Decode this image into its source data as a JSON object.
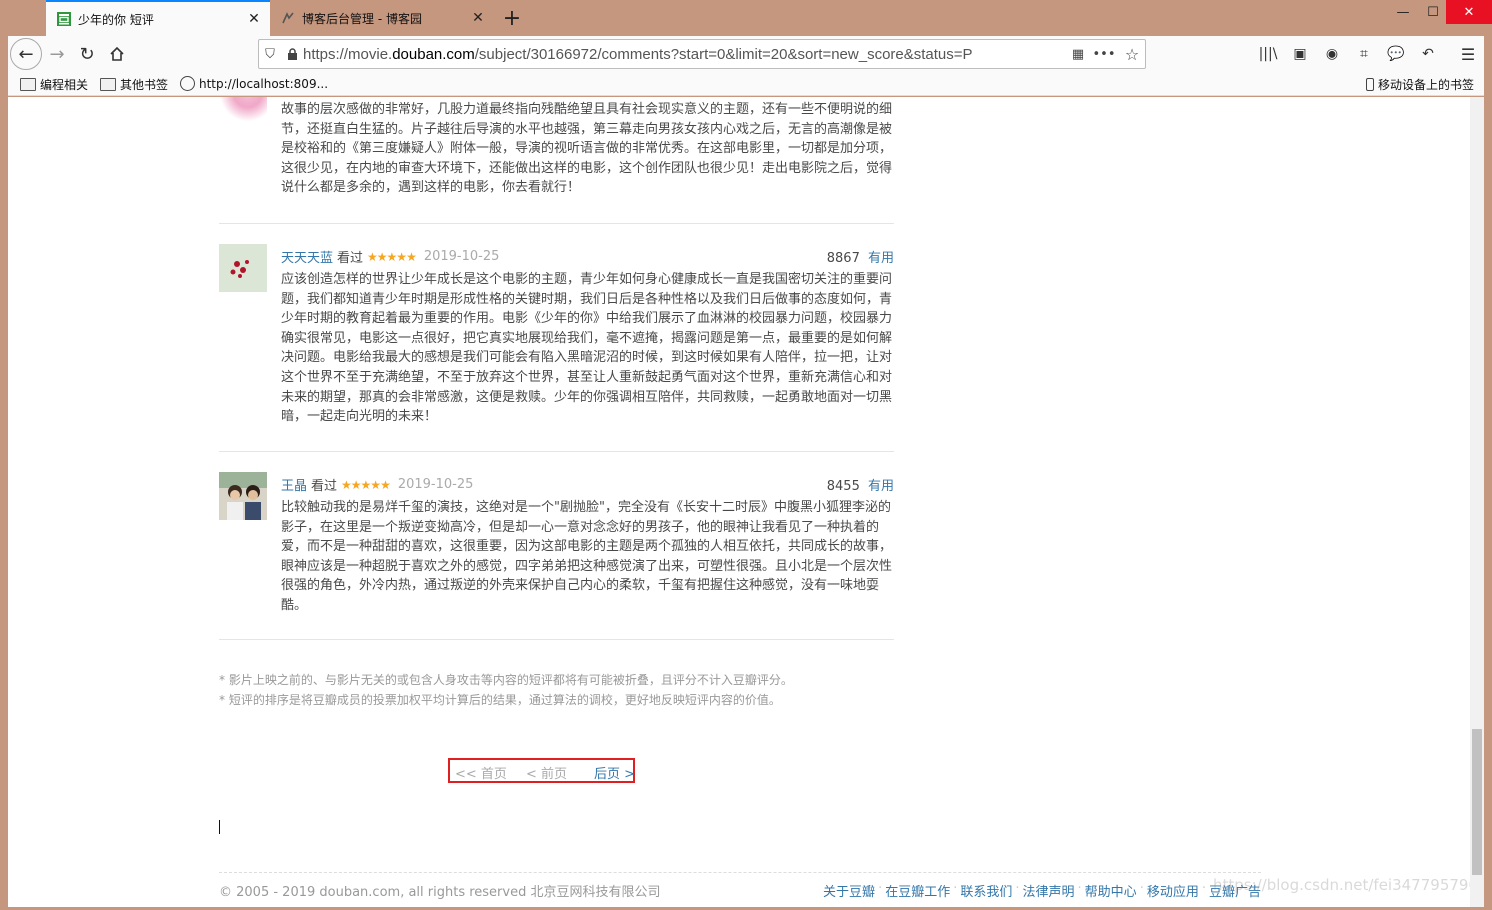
{
  "browser": {
    "tabs": [
      {
        "title": "少年的你 短评",
        "active": true,
        "icon": "douban-icon"
      },
      {
        "title": "博客后台管理 - 博客园",
        "active": false,
        "icon": "cnblogs-icon"
      }
    ],
    "url_prefix": "https://movie.",
    "url_domain": "douban.com",
    "url_rest": "/subject/30166972/comments?start=0&limit=20&sort=new_score&status=P",
    "bookmarks": [
      {
        "label": "编程相关",
        "icon": "folder-icon"
      },
      {
        "label": "其他书签",
        "icon": "folder-icon"
      },
      {
        "label": "http://localhost:809...",
        "icon": "globe-icon"
      }
    ],
    "mobile_bookmarks": "移动设备上的书签"
  },
  "comments": [
    {
      "user": "",
      "text": "故事的层次感做的非常好，几股力道最终指向残酷绝望且具有社会现实意义的主题，还有一些不便明说的细节，还挺直白生猛的。片子越往后导演的水平也越强，第三幕走向男孩女孩内心戏之后，无言的高潮像是被是校裕和的《第三度嫌疑人》附体一般，导演的视听语言做的非常优秀。在这部电影里，一切都是加分项，这很少见，在内地的审查大环境下，还能做出这样的电影，这个创作团队也很少见！走出电影院之后，觉得说什么都是多余的，遇到这样的电影，你去看就行！"
    },
    {
      "user": "天天天蓝",
      "watched": "看过",
      "stars": "★★★★★",
      "date": "2019-10-25",
      "votes": "8867",
      "useful": "有用",
      "text": "应该创造怎样的世界让少年成长是这个电影的主题，青少年如何身心健康成长一直是我国密切关注的重要问题，我们都知道青少年时期是形成性格的关键时期，我们日后是各种性格以及我们日后做事的态度如何，青少年时期的教育起着最为重要的作用。电影《少年的你》中给我们展示了血淋淋的校园暴力问题，校园暴力确实很常见，电影这一点很好，把它真实地展现给我们，毫不遮掩，揭露问题是第一点，最重要的是如何解决问题。电影给我最大的感想是我们可能会有陷入黑暗泥沼的时候，到这时候如果有人陪伴，拉一把，让对这个世界不至于充满绝望，不至于放弃这个世界，甚至让人重新鼓起勇气面对这个世界，重新充满信心和对未来的期望，那真的会非常感激，这便是救赎。少年的你强调相互陪伴，共同救赎，一起勇敢地面对一切黑暗，一起走向光明的未来！"
    },
    {
      "user": "王晶",
      "watched": "看过",
      "stars": "★★★★★",
      "date": "2019-10-25",
      "votes": "8455",
      "useful": "有用",
      "text": "比较触动我的是易烊千玺的演技，这绝对是一个\"剧抛脸\"，完全没有《长安十二时辰》中腹黑小狐狸李泌的影子，在这里是一个叛逆变拗高冷，但是却一心一意对念念好的男孩子，他的眼神让我看见了一种执着的爱，而不是一种甜甜的喜欢，这很重要，因为这部电影的主题是两个孤独的人相互依托，共同成长的故事，眼神应该是一种超脱于喜欢之外的感觉，四字弟弟把这种感觉演了出来，可塑性很强。且小北是一个层次性很强的角色，外冷内热，通过叛逆的外壳来保护自己内心的柔软，千玺有把握住这种感觉，没有一味地耍酷。"
    }
  ],
  "notes": [
    "* 影片上映之前的、与影片无关的或包含人身攻击等内容的短评都将有可能被折叠，且评分不计入豆瓣评分。",
    "* 短评的排序是将豆瓣成员的投票加权平均计算后的结果，通过算法的调校，更好地反映短评内容的价值。"
  ],
  "pager": {
    "first": "<< 首页",
    "prev": "< 前页",
    "next": "后页 >"
  },
  "footer": {
    "copyright": "© 2005 - 2019 douban.com, all rights reserved 北京豆网科技有限公司",
    "links": [
      "关于豆瓣",
      "在豆瓣工作",
      "联系我们",
      "法律声明",
      "帮助中心",
      "移动应用",
      "豆瓣广告"
    ],
    "watermark": "https://blog.csdn.net/fei347795790"
  }
}
